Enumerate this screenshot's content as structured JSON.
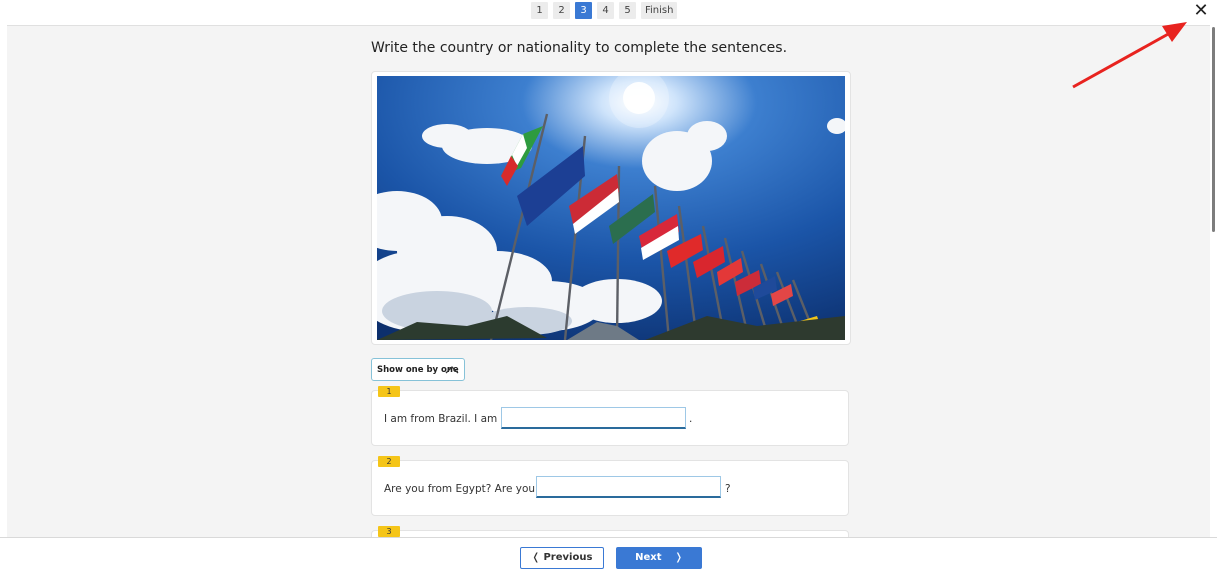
{
  "pager": {
    "pages": [
      "1",
      "2",
      "3",
      "4",
      "5"
    ],
    "active_page": "3",
    "finish_label": "Finish"
  },
  "instruction": "Write the country or nationality to complete the sentences.",
  "toggle_label": "Show one by one",
  "questions": [
    {
      "number": "1",
      "before": "I am from Brazil. I am",
      "value": "",
      "after": "."
    },
    {
      "number": "2",
      "before": "Are you from Egypt? Are you",
      "value": "",
      "after": "?"
    },
    {
      "number": "3"
    }
  ],
  "nav": {
    "previous_label": "Previous",
    "next_label": "Next"
  },
  "icons": {
    "close": "close-icon",
    "toggle": "chevron-up-icon",
    "previous": "chevron-left-icon",
    "next": "chevron-right-icon",
    "annotation": "red-arrow-icon"
  },
  "colors": {
    "accent": "#3a79d4",
    "badge": "#f5c518",
    "annotation_arrow": "#e8231f"
  }
}
